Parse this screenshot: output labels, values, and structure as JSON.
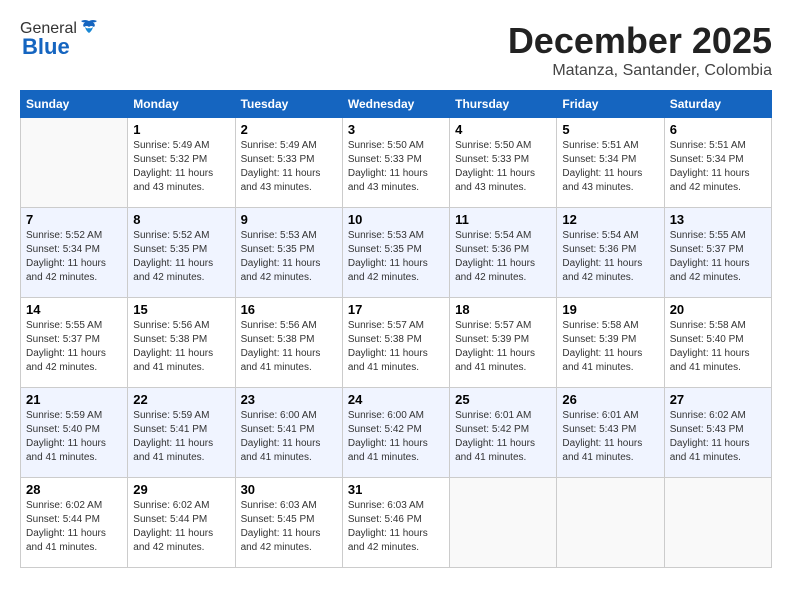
{
  "logo": {
    "general": "General",
    "blue": "Blue"
  },
  "header": {
    "month": "December 2025",
    "location": "Matanza, Santander, Colombia"
  },
  "weekdays": [
    "Sunday",
    "Monday",
    "Tuesday",
    "Wednesday",
    "Thursday",
    "Friday",
    "Saturday"
  ],
  "weeks": [
    [
      {
        "day": "",
        "info": ""
      },
      {
        "day": "1",
        "info": "Sunrise: 5:49 AM\nSunset: 5:32 PM\nDaylight: 11 hours\nand 43 minutes."
      },
      {
        "day": "2",
        "info": "Sunrise: 5:49 AM\nSunset: 5:33 PM\nDaylight: 11 hours\nand 43 minutes."
      },
      {
        "day": "3",
        "info": "Sunrise: 5:50 AM\nSunset: 5:33 PM\nDaylight: 11 hours\nand 43 minutes."
      },
      {
        "day": "4",
        "info": "Sunrise: 5:50 AM\nSunset: 5:33 PM\nDaylight: 11 hours\nand 43 minutes."
      },
      {
        "day": "5",
        "info": "Sunrise: 5:51 AM\nSunset: 5:34 PM\nDaylight: 11 hours\nand 43 minutes."
      },
      {
        "day": "6",
        "info": "Sunrise: 5:51 AM\nSunset: 5:34 PM\nDaylight: 11 hours\nand 42 minutes."
      }
    ],
    [
      {
        "day": "7",
        "info": "Sunrise: 5:52 AM\nSunset: 5:34 PM\nDaylight: 11 hours\nand 42 minutes."
      },
      {
        "day": "8",
        "info": "Sunrise: 5:52 AM\nSunset: 5:35 PM\nDaylight: 11 hours\nand 42 minutes."
      },
      {
        "day": "9",
        "info": "Sunrise: 5:53 AM\nSunset: 5:35 PM\nDaylight: 11 hours\nand 42 minutes."
      },
      {
        "day": "10",
        "info": "Sunrise: 5:53 AM\nSunset: 5:35 PM\nDaylight: 11 hours\nand 42 minutes."
      },
      {
        "day": "11",
        "info": "Sunrise: 5:54 AM\nSunset: 5:36 PM\nDaylight: 11 hours\nand 42 minutes."
      },
      {
        "day": "12",
        "info": "Sunrise: 5:54 AM\nSunset: 5:36 PM\nDaylight: 11 hours\nand 42 minutes."
      },
      {
        "day": "13",
        "info": "Sunrise: 5:55 AM\nSunset: 5:37 PM\nDaylight: 11 hours\nand 42 minutes."
      }
    ],
    [
      {
        "day": "14",
        "info": "Sunrise: 5:55 AM\nSunset: 5:37 PM\nDaylight: 11 hours\nand 42 minutes."
      },
      {
        "day": "15",
        "info": "Sunrise: 5:56 AM\nSunset: 5:38 PM\nDaylight: 11 hours\nand 41 minutes."
      },
      {
        "day": "16",
        "info": "Sunrise: 5:56 AM\nSunset: 5:38 PM\nDaylight: 11 hours\nand 41 minutes."
      },
      {
        "day": "17",
        "info": "Sunrise: 5:57 AM\nSunset: 5:38 PM\nDaylight: 11 hours\nand 41 minutes."
      },
      {
        "day": "18",
        "info": "Sunrise: 5:57 AM\nSunset: 5:39 PM\nDaylight: 11 hours\nand 41 minutes."
      },
      {
        "day": "19",
        "info": "Sunrise: 5:58 AM\nSunset: 5:39 PM\nDaylight: 11 hours\nand 41 minutes."
      },
      {
        "day": "20",
        "info": "Sunrise: 5:58 AM\nSunset: 5:40 PM\nDaylight: 11 hours\nand 41 minutes."
      }
    ],
    [
      {
        "day": "21",
        "info": "Sunrise: 5:59 AM\nSunset: 5:40 PM\nDaylight: 11 hours\nand 41 minutes."
      },
      {
        "day": "22",
        "info": "Sunrise: 5:59 AM\nSunset: 5:41 PM\nDaylight: 11 hours\nand 41 minutes."
      },
      {
        "day": "23",
        "info": "Sunrise: 6:00 AM\nSunset: 5:41 PM\nDaylight: 11 hours\nand 41 minutes."
      },
      {
        "day": "24",
        "info": "Sunrise: 6:00 AM\nSunset: 5:42 PM\nDaylight: 11 hours\nand 41 minutes."
      },
      {
        "day": "25",
        "info": "Sunrise: 6:01 AM\nSunset: 5:42 PM\nDaylight: 11 hours\nand 41 minutes."
      },
      {
        "day": "26",
        "info": "Sunrise: 6:01 AM\nSunset: 5:43 PM\nDaylight: 11 hours\nand 41 minutes."
      },
      {
        "day": "27",
        "info": "Sunrise: 6:02 AM\nSunset: 5:43 PM\nDaylight: 11 hours\nand 41 minutes."
      }
    ],
    [
      {
        "day": "28",
        "info": "Sunrise: 6:02 AM\nSunset: 5:44 PM\nDaylight: 11 hours\nand 41 minutes."
      },
      {
        "day": "29",
        "info": "Sunrise: 6:02 AM\nSunset: 5:44 PM\nDaylight: 11 hours\nand 42 minutes."
      },
      {
        "day": "30",
        "info": "Sunrise: 6:03 AM\nSunset: 5:45 PM\nDaylight: 11 hours\nand 42 minutes."
      },
      {
        "day": "31",
        "info": "Sunrise: 6:03 AM\nSunset: 5:46 PM\nDaylight: 11 hours\nand 42 minutes."
      },
      {
        "day": "",
        "info": ""
      },
      {
        "day": "",
        "info": ""
      },
      {
        "day": "",
        "info": ""
      }
    ]
  ]
}
